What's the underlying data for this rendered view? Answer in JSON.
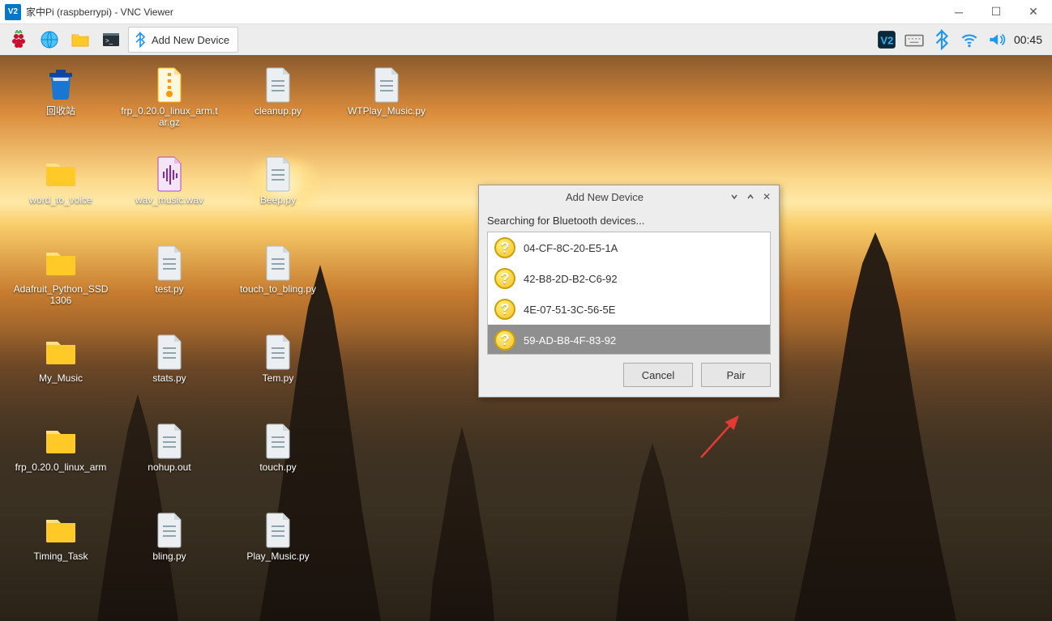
{
  "window": {
    "title": "家中Pi (raspberrypi) - VNC Viewer"
  },
  "taskbar": {
    "task_label": "Add New Device",
    "clock": "00:45"
  },
  "desktop_icons": [
    {
      "type": "trash",
      "label": "回收站"
    },
    {
      "type": "archive",
      "label": "frp_0.20.0_linux_arm.tar.gz"
    },
    {
      "type": "file",
      "label": "cleanup.py"
    },
    {
      "type": "file",
      "label": "WTPlay_Music.py"
    },
    {
      "type": "folder",
      "label": "word_to_voice"
    },
    {
      "type": "audio",
      "label": "wav_music.wav"
    },
    {
      "type": "file",
      "label": "Beep.py"
    },
    {
      "type": "blank",
      "label": ""
    },
    {
      "type": "folder",
      "label": "Adafruit_Python_SSD1306"
    },
    {
      "type": "file",
      "label": "test.py"
    },
    {
      "type": "file",
      "label": "touch_to_bling.py"
    },
    {
      "type": "blank",
      "label": ""
    },
    {
      "type": "folder",
      "label": "My_Music"
    },
    {
      "type": "file",
      "label": "stats.py"
    },
    {
      "type": "file",
      "label": "Tem.py"
    },
    {
      "type": "blank",
      "label": ""
    },
    {
      "type": "folder",
      "label": "frp_0.20.0_linux_arm"
    },
    {
      "type": "file",
      "label": "nohup.out"
    },
    {
      "type": "file",
      "label": "touch.py"
    },
    {
      "type": "blank",
      "label": ""
    },
    {
      "type": "folder",
      "label": "Timing_Task"
    },
    {
      "type": "file",
      "label": "bling.py"
    },
    {
      "type": "file",
      "label": "Play_Music.py"
    },
    {
      "type": "blank",
      "label": ""
    }
  ],
  "dialog": {
    "title": "Add New Device",
    "status": "Searching for Bluetooth devices...",
    "devices": [
      {
        "mac": "04-CF-8C-20-E5-1A",
        "selected": false
      },
      {
        "mac": "42-B8-2D-B2-C6-92",
        "selected": false
      },
      {
        "mac": "4E-07-51-3C-56-5E",
        "selected": false
      },
      {
        "mac": "59-AD-B8-4F-83-92",
        "selected": true
      }
    ],
    "cancel": "Cancel",
    "pair": "Pair"
  }
}
